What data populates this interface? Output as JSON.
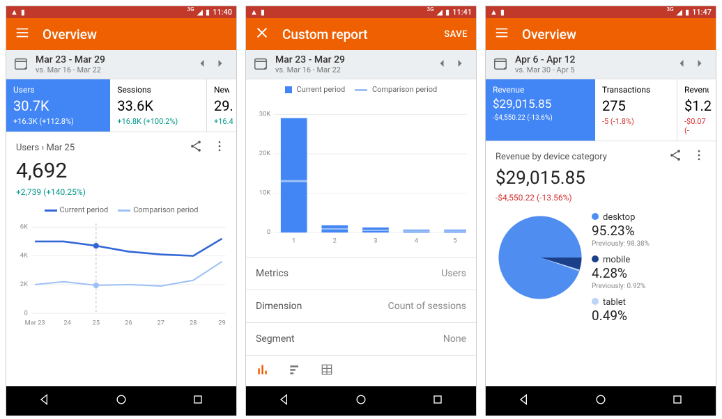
{
  "screens": [
    {
      "status_time": "11:40",
      "status_net": "3G",
      "app_bar_title": "Overview",
      "app_bar_left": "menu",
      "date_range": "Mar 23 - Mar 29",
      "date_compare": "vs. Mar 16 - Mar 22",
      "cards": [
        {
          "label": "Users",
          "value": "30.7K",
          "delta": "+16.3K (+112.8%)",
          "selected": true,
          "delta_sign": "pos"
        },
        {
          "label": "Sessions",
          "value": "33.6K",
          "delta": "+16.8K (+100.2%)",
          "selected": false,
          "delta_sign": "pos"
        },
        {
          "label": "New u",
          "value": "29.",
          "delta": "+16.4",
          "selected": false,
          "delta_sign": "pos",
          "cut": true
        }
      ],
      "detail_crumb": "Users › Mar 25",
      "big_value": "4,692",
      "big_delta": "+2,739 (+140.25%)",
      "big_delta_sign": "pos",
      "legend_primary": "Current period",
      "legend_secondary": "Comparison period"
    },
    {
      "status_time": "11:41",
      "status_net": "3G",
      "app_bar_title": "Custom report",
      "app_bar_left": "close",
      "app_bar_action": "SAVE",
      "date_range": "Mar 23 - Mar 29",
      "date_compare": "vs. Mar 16 - Mar 22",
      "legend_primary": "Current period",
      "legend_secondary": "Comparison period",
      "options": [
        {
          "label": "Metrics",
          "value": "Users"
        },
        {
          "label": "Dimension",
          "value": "Count of sessions"
        },
        {
          "label": "Segment",
          "value": "None"
        }
      ]
    },
    {
      "status_time": "11:47",
      "status_net": "3G",
      "app_bar_title": "Overview",
      "app_bar_left": "menu",
      "date_range": "Apr 6 - Apr 12",
      "date_compare": "vs. Mar 30 - Apr 5",
      "cards": [
        {
          "label": "Revenue",
          "value": "$29,015.85",
          "delta": "-$4,550.22 (-13.6%)",
          "selected": true,
          "delta_sign": "neg"
        },
        {
          "label": "Transactions",
          "value": "275",
          "delta": "-5 (-1.8%)",
          "selected": false,
          "delta_sign": "neg"
        },
        {
          "label": "Revenue",
          "value": "$1.2",
          "delta": "-$0.07 (-",
          "selected": false,
          "delta_sign": "neg",
          "cut": true
        }
      ],
      "detail_crumb": "Revenue by device category",
      "big_value": "$29,015.85",
      "big_delta": "-$4,550.22 (-13.56%)",
      "big_delta_sign": "neg",
      "pie_legend": [
        {
          "name": "desktop",
          "pct": "95.23%",
          "prev": "Previously: 98.38%",
          "color": "#4f8ef0"
        },
        {
          "name": "mobile",
          "pct": "4.28%",
          "prev": "Previously: 0.92%",
          "color": "#1c3f8a"
        },
        {
          "name": "tablet",
          "pct": "0.49%",
          "prev": "",
          "color": "#bcd4f5"
        }
      ]
    }
  ],
  "chart_data": [
    {
      "type": "line",
      "title": "Users — Mar 23 to Mar 29",
      "x": [
        "Mar 23",
        "24",
        "25",
        "26",
        "27",
        "28",
        "29"
      ],
      "series": [
        {
          "name": "Current period",
          "values": [
            5000,
            5000,
            4692,
            4300,
            4100,
            4000,
            5200
          ]
        },
        {
          "name": "Comparison period",
          "values": [
            2000,
            2200,
            1953,
            2000,
            1900,
            2300,
            3600
          ]
        }
      ],
      "ylim": [
        0,
        6000
      ],
      "y_ticks": [
        0,
        2000,
        4000,
        6000
      ],
      "y_tick_labels": [
        "0",
        "2K",
        "4K",
        "6K"
      ],
      "highlight_index": 2
    },
    {
      "type": "bar",
      "title": "Custom report — Users by Count of sessions",
      "categories": [
        "1",
        "2",
        "3",
        "4",
        "5"
      ],
      "series": [
        {
          "name": "Current period",
          "values": [
            29000,
            1800,
            1200,
            600,
            600
          ]
        },
        {
          "name": "Comparison period",
          "values": [
            13000,
            900,
            600,
            400,
            400
          ]
        }
      ],
      "ylim": [
        0,
        30000
      ],
      "y_ticks": [
        0,
        10000,
        20000,
        30000
      ],
      "y_tick_labels": [
        "0",
        "10K",
        "20K",
        "30K"
      ]
    },
    {
      "type": "pie",
      "title": "Revenue by device category",
      "slices": [
        {
          "name": "desktop",
          "value": 95.23,
          "color": "#4f8ef0"
        },
        {
          "name": "mobile",
          "value": 4.28,
          "color": "#1c3f8a"
        },
        {
          "name": "tablet",
          "value": 0.49,
          "color": "#bcd4f5"
        }
      ]
    }
  ]
}
